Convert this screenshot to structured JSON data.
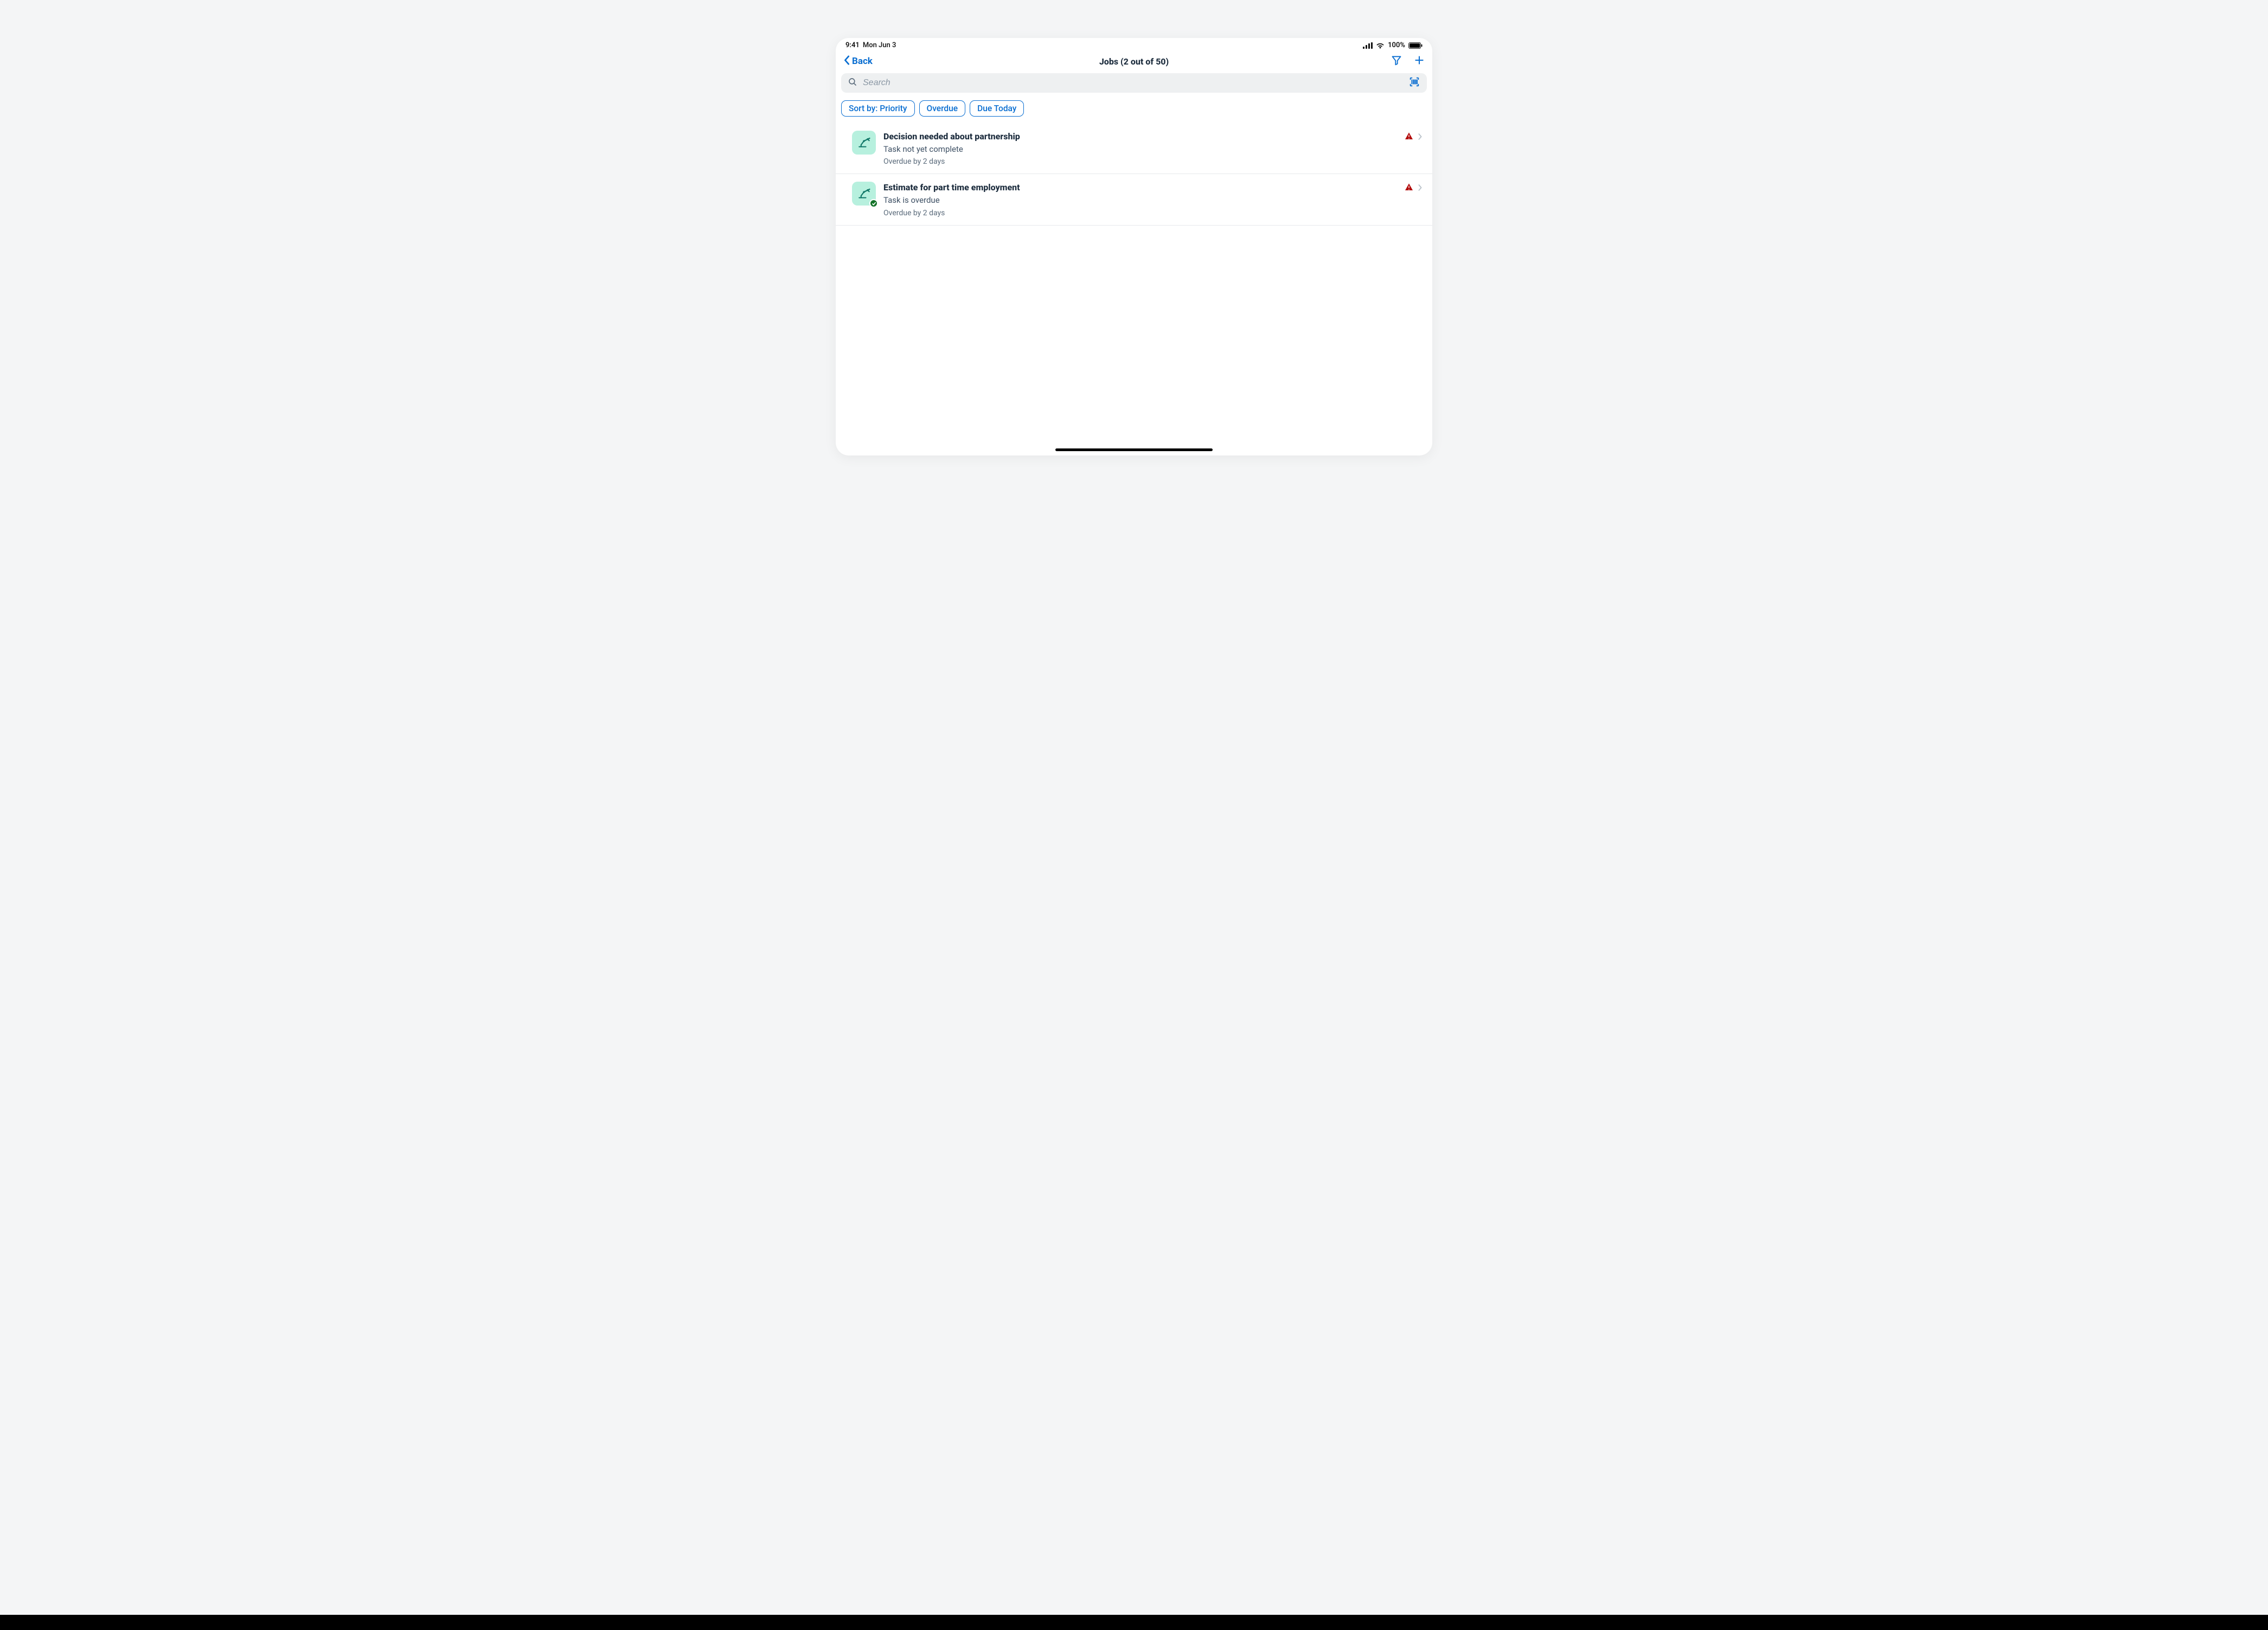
{
  "statusbar": {
    "time": "9:41",
    "date": "Mon Jun 3",
    "battery_pct": "100%"
  },
  "header": {
    "back_label": "Back",
    "title": "Jobs (2 out of 50)"
  },
  "search": {
    "placeholder": "Search"
  },
  "chips": {
    "sort": "Sort by: Priority",
    "overdue": "Overdue",
    "due_today": "Due Today"
  },
  "jobs": [
    {
      "title": "Decision needed about partnership",
      "subtitle": "Task not yet complete",
      "meta": "Overdue by 2 days",
      "has_check_badge": false,
      "has_warning": true
    },
    {
      "title": "Estimate for part time employment",
      "subtitle": "Task is overdue",
      "meta": "Overdue by 2 days",
      "has_check_badge": true,
      "has_warning": true
    }
  ]
}
